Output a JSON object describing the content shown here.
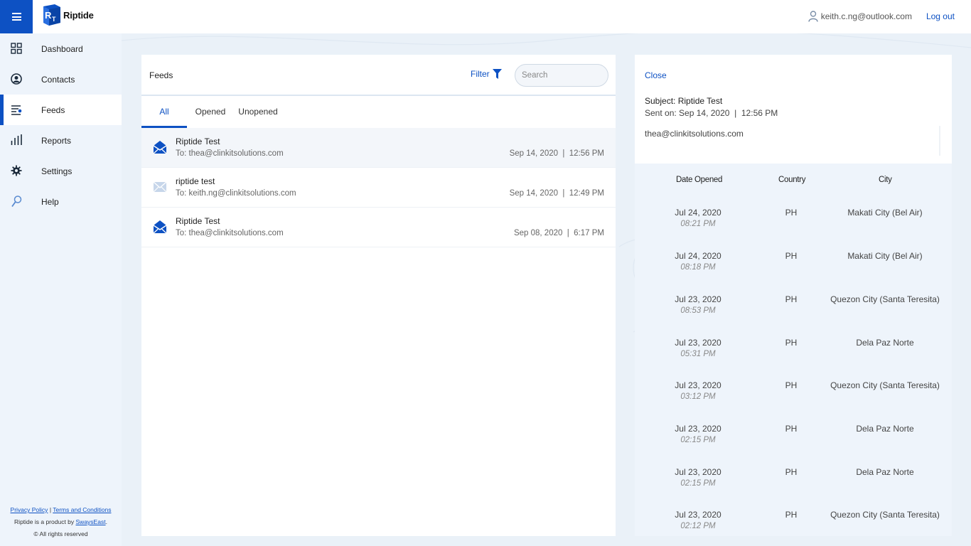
{
  "app": {
    "brand_name": "Riptide",
    "user_email": "keith.c.ng@outlook.com",
    "logout_label": "Log out",
    "accent_color": "#0d51c3"
  },
  "sidebar": {
    "items": [
      {
        "label": "Dashboard",
        "icon": "dashboard-icon"
      },
      {
        "label": "Contacts",
        "icon": "contacts-icon"
      },
      {
        "label": "Feeds",
        "icon": "feeds-icon",
        "active": true
      },
      {
        "label": "Reports",
        "icon": "reports-icon"
      },
      {
        "label": "Settings",
        "icon": "settings-icon"
      },
      {
        "label": "Help",
        "icon": "help-icon"
      }
    ],
    "footer": {
      "privacy_label": "Privacy Policy",
      "separator": "|",
      "terms_label": "Terms and Conditions",
      "product_prefix": "Riptide is a product by ",
      "company_link": "SwaysEast",
      "product_suffix": ".",
      "rights": "© All rights reserved"
    }
  },
  "feeds": {
    "title": "Feeds",
    "filter_label": "Filter",
    "search_placeholder": "Search",
    "tabs": [
      {
        "label": "All",
        "active": true
      },
      {
        "label": "Opened"
      },
      {
        "label": "Unopened"
      }
    ],
    "rows": [
      {
        "subject": "Riptide Test",
        "to": "To: thea@clinkitsolutions.com",
        "date": "Sep 14, 2020  |  12:56 PM",
        "status": "opened",
        "selected": true
      },
      {
        "subject": "riptide test",
        "to": "To: keith.ng@clinkitsolutions.com",
        "date": "Sep 14, 2020  |  12:49 PM",
        "status": "unopened"
      },
      {
        "subject": "Riptide Test",
        "to": "To: thea@clinkitsolutions.com",
        "date": "Sep 08, 2020  |  6:17 PM",
        "status": "opened"
      }
    ]
  },
  "detail": {
    "close_label": "Close",
    "subject": "Subject: Riptide Test",
    "sent_on": "Sent on: Sep 14, 2020  |  12:56 PM",
    "recipient": "thea@clinkitsolutions.com",
    "columns": {
      "date": "Date Opened",
      "country": "Country",
      "city": "City"
    },
    "opens": [
      {
        "date": "Jul 24, 2020",
        "time": "08:21 PM",
        "country": "PH",
        "city": "Makati City (Bel Air)"
      },
      {
        "date": "Jul 24, 2020",
        "time": "08:18 PM",
        "country": "PH",
        "city": "Makati City (Bel Air)"
      },
      {
        "date": "Jul 23, 2020",
        "time": "08:53 PM",
        "country": "PH",
        "city": "Quezon City (Santa Teresita)"
      },
      {
        "date": "Jul 23, 2020",
        "time": "05:31 PM",
        "country": "PH",
        "city": "Dela Paz Norte"
      },
      {
        "date": "Jul 23, 2020",
        "time": "03:12 PM",
        "country": "PH",
        "city": "Quezon City (Santa Teresita)"
      },
      {
        "date": "Jul 23, 2020",
        "time": "02:15 PM",
        "country": "PH",
        "city": "Dela Paz Norte"
      },
      {
        "date": "Jul 23, 2020",
        "time": "02:15 PM",
        "country": "PH",
        "city": "Dela Paz Norte"
      },
      {
        "date": "Jul 23, 2020",
        "time": "02:12 PM",
        "country": "PH",
        "city": "Quezon City (Santa Teresita)"
      }
    ]
  }
}
